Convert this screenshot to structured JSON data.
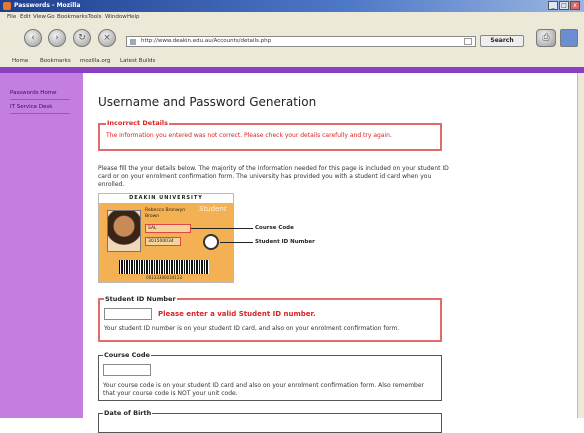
{
  "window": {
    "title": "Passwords - Mozilla"
  },
  "menu": [
    "File",
    "Edit",
    "View",
    "Go",
    "Bookmarks",
    "Tools",
    "Window",
    "Help"
  ],
  "nav": {
    "url": "http://www.deakin.edu.au/Accounts/details.php",
    "search_label": "Search"
  },
  "links": [
    "Home",
    "Bookmarks",
    "mozilla.org",
    "Latest Builds"
  ],
  "sidebar": {
    "items": [
      "Passwords Home",
      "IT Service Desk"
    ]
  },
  "page": {
    "title": "Username and Password Generation",
    "error": {
      "legend": "Incorrect Details",
      "text": "The information you entered was not correct. Please check your details carefully and try again."
    },
    "intro": "Please fill the your details below. The majority of the information needed for this page is included on your student ID card or on your enrolment confirmation form. The university has provided you with a student id card when you enrolled.",
    "card": {
      "header": "DEAKIN UNIVERSITY",
      "name_lines": [
        "Rebecca Bronwyn",
        "Brown"
      ],
      "course_value": "SAL",
      "id_value": "301500034",
      "brand": "Student",
      "barcode_number": "00133300034113",
      "course_code_label": "Course Code",
      "student_id_label": "Student ID Number"
    },
    "student_id": {
      "legend": "Student ID Number",
      "error_msg": "Please enter a valid Student ID number.",
      "help": "Your student ID number is on your student ID card, and also on your enrolment confirmation form."
    },
    "course_code": {
      "legend": "Course Code",
      "help": "Your course code is on your student ID card and also on your enrolment confirmation form. Also remember that your course code is NOT your unit code."
    },
    "dob": {
      "legend": "Date of Birth"
    }
  },
  "colors": {
    "sidebar": "#c47ee0",
    "purple_bar": "#8a3fc2",
    "error": "#dd2222"
  }
}
